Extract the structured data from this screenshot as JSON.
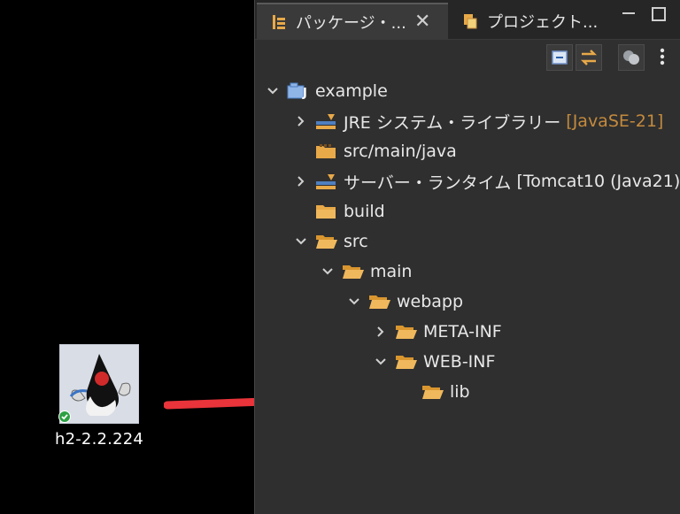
{
  "desktop": {
    "icon_label": "h2-2.2.224"
  },
  "panel": {
    "tabs": [
      {
        "label": "パッケージ・...",
        "active": true
      },
      {
        "label": "プロジェクト...",
        "active": false
      }
    ],
    "tree": [
      {
        "label": "example",
        "tag": "",
        "depth": 0,
        "expanded": true
      },
      {
        "label": "JRE システム・ライブラリー",
        "tag": "[JavaSE-21]",
        "depth": 1,
        "expanded": false
      },
      {
        "label": "src/main/java",
        "tag": "",
        "depth": 1,
        "expanded": null
      },
      {
        "label": "サーバー・ランタイム",
        "tag": "[Tomcat10 (Java21)]",
        "depth": 1,
        "expanded": false
      },
      {
        "label": "build",
        "tag": "",
        "depth": 1,
        "expanded": null
      },
      {
        "label": "src",
        "tag": "",
        "depth": 1,
        "expanded": true
      },
      {
        "label": "main",
        "tag": "",
        "depth": 2,
        "expanded": true
      },
      {
        "label": "webapp",
        "tag": "",
        "depth": 3,
        "expanded": true
      },
      {
        "label": "META-INF",
        "tag": "",
        "depth": 4,
        "expanded": false
      },
      {
        "label": "WEB-INF",
        "tag": "",
        "depth": 4,
        "expanded": true
      },
      {
        "label": "lib",
        "tag": "",
        "depth": 5,
        "expanded": null
      }
    ]
  },
  "colors": {
    "background": "#000000",
    "panel": "#2f2f2f",
    "folder": "#e8a948",
    "tag_orange": "#c48a3d",
    "arrow": "#e8343a",
    "badge_green": "#2ea043"
  },
  "icons": {
    "desktop_app": "duke-java-icon",
    "tab_package": "package-explorer-icon",
    "tab_project": "project-explorer-icon",
    "toolbar": [
      "collapse-all-icon",
      "link-with-editor-icon",
      "filter-icon",
      "view-menu-icon"
    ]
  }
}
